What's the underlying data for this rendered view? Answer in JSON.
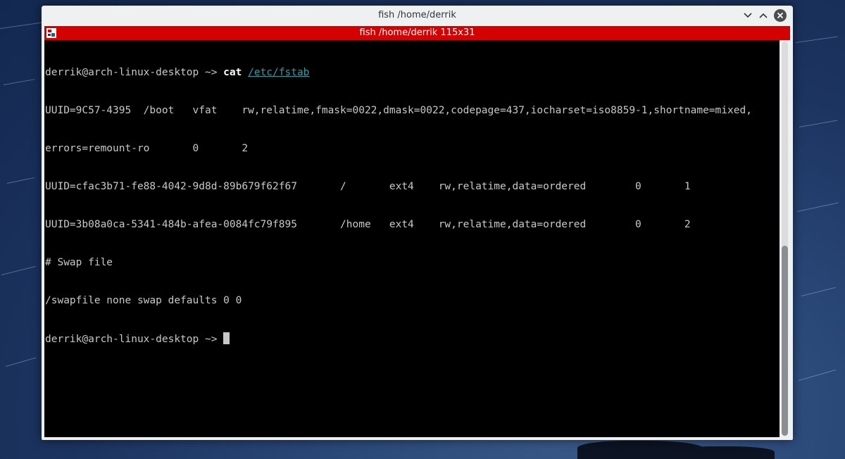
{
  "window": {
    "title": "fish /home/derrik"
  },
  "tab": {
    "label": "fish  /home/derrik 115x31"
  },
  "terminal": {
    "prompt": "derrik@arch-linux-desktop ~> ",
    "command": "cat",
    "argument": "/etc/fstab",
    "output": [
      "UUID=9C57-4395  /boot   vfat    rw,relatime,fmask=0022,dmask=0022,codepage=437,iocharset=iso8859-1,shortname=mixed,",
      "errors=remount-ro       0       2",
      "UUID=cfac3b71-fe88-4042-9d8d-89b679f62f67       /       ext4    rw,relatime,data=ordered        0       1",
      "UUID=3b08a0ca-5341-484b-afea-0084fc79f895       /home   ext4    rw,relatime,data=ordered        0       2",
      "# Swap file",
      "/swapfile none swap defaults 0 0"
    ],
    "second_prompt": "derrik@arch-linux-desktop ~> "
  },
  "icons": {
    "minimize": "chevron-down-icon",
    "maximize": "chevron-up-icon",
    "close": "close-icon",
    "tab": "konsole-tab-icon"
  },
  "colors": {
    "tabbar": "#d50000",
    "terminal_bg": "#000000",
    "terminal_fg": "#c8c8c8",
    "link": "#22a0a8"
  },
  "scrollbar": {
    "position": 1.0
  }
}
